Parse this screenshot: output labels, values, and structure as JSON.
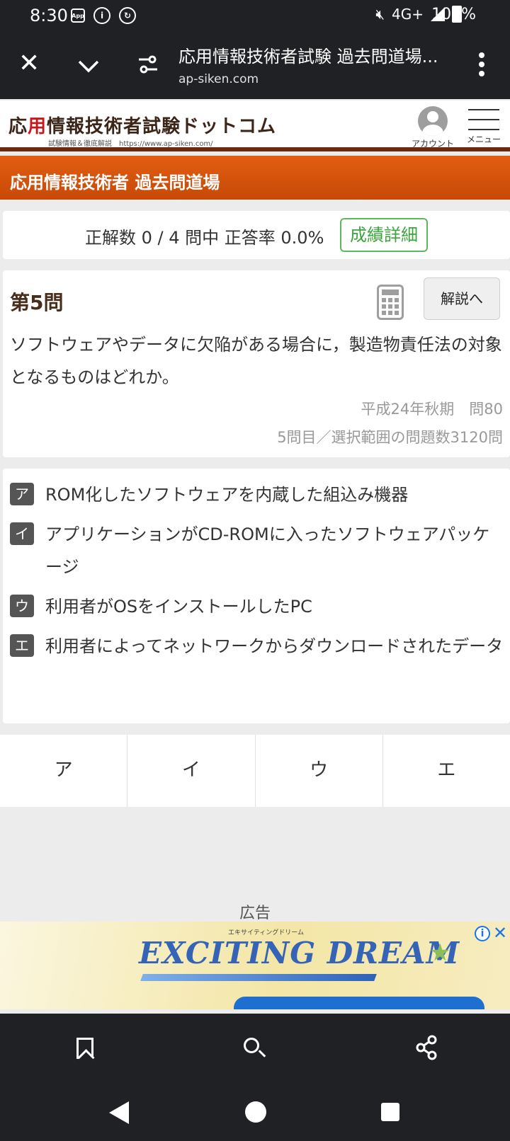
{
  "status_bar": {
    "time": "8:30",
    "network": "4G+",
    "battery": "100%",
    "app_icon_text": "App"
  },
  "browser": {
    "title": "応用情報技術者試験 過去問道場...",
    "url": "ap-siken.com"
  },
  "site": {
    "logo_prefix": "応",
    "logo_red": "用",
    "logo_rest": "情報技術者試験ドットコム",
    "logo_sub": "試験情報＆徹底解説　https://www.ap-siken.com/",
    "account_label": "アカウント",
    "menu_label": "メニュー"
  },
  "section_title": "応用情報技術者 過去問道場",
  "score": {
    "text": "正解数 0 / 4 問中 正答率 0.0%",
    "details_button": "成績詳細"
  },
  "question": {
    "title": "第5問",
    "explain_button": "解説へ",
    "text": "ソフトウェアやデータに欠陥がある場合に，製造物責任法の対象となるものはどれか。",
    "source": "平成24年秋期　問80",
    "count": "5問目／選択範囲の問題数3120問"
  },
  "choices": [
    {
      "badge": "ア",
      "text": "ROM化したソフトウェアを内蔵した組込み機器"
    },
    {
      "badge": "イ",
      "text": "アプリケーションがCD-ROMに入ったソフトウェアパッケージ"
    },
    {
      "badge": "ウ",
      "text": "利用者がOSをインストールしたPC"
    },
    {
      "badge": "エ",
      "text": "利用者によってネットワークからダウンロードされたデータ"
    }
  ],
  "answer_buttons": [
    "ア",
    "イ",
    "ウ",
    "エ"
  ],
  "ad": {
    "label": "広告",
    "brand_small": "エキサイティングドリーム",
    "brand": "EXCITING DREAM",
    "info": "i",
    "close": "✕"
  },
  "colors": {
    "section_bar": "#d4560c",
    "header_underline": "#6b2a0e",
    "score_button": "#5cb85c",
    "choice_badge": "#555555"
  }
}
